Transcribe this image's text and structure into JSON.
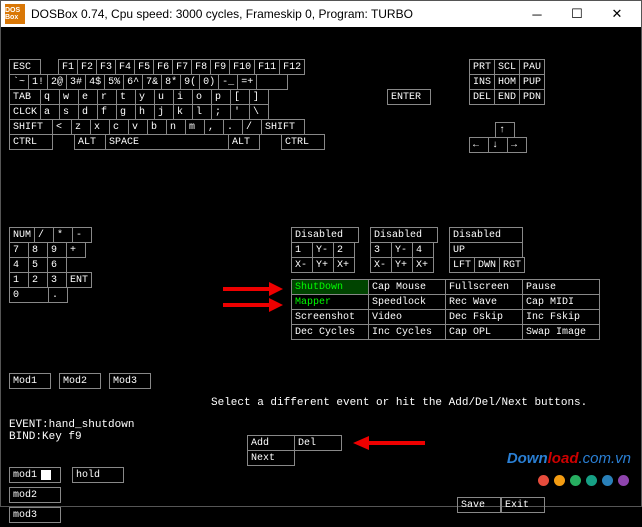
{
  "title": "DOSBox 0.74, Cpu speed:    3000 cycles, Frameskip  0, Program:    TURBO",
  "icon_text": "DOS\nBox",
  "winbtns": {
    "min": "─",
    "max": "☐",
    "close": "✕"
  },
  "kb": {
    "r0": [
      "ESC",
      "",
      "F1",
      "F2",
      "F3",
      "F4",
      "F5",
      "F6",
      "F7",
      "F8",
      "F9",
      "F10",
      "F11",
      "F12"
    ],
    "r1": [
      "`~",
      "1!",
      "2@",
      "3#",
      "4$",
      "5%",
      "6^",
      "7&",
      "8*",
      "9(",
      "0)",
      "-_",
      "=+",
      ""
    ],
    "r2": [
      "TAB",
      "q",
      "w",
      "e",
      "r",
      "t",
      "y",
      "u",
      "i",
      "o",
      "p",
      "[",
      "]"
    ],
    "r3": [
      "CLCK",
      "a",
      "s",
      "d",
      "f",
      "g",
      "h",
      "j",
      "k",
      "l",
      ";",
      "'",
      "\\"
    ],
    "r4": [
      "SHIFT",
      "<",
      "z",
      "x",
      "c",
      "v",
      "b",
      "n",
      "m",
      ",",
      ".",
      "/",
      "SHIFT"
    ],
    "r5": [
      "CTRL",
      "",
      "ALT",
      "SPACE",
      "",
      "",
      "ALT",
      "",
      "CTRL"
    ]
  },
  "kb_right": {
    "r0": [
      "PRT",
      "SCL",
      "PAU"
    ],
    "r1": [
      "INS",
      "HOM",
      "PUP"
    ],
    "r2": [
      "DEL",
      "END",
      "PDN"
    ],
    "enter": "ENTER",
    "arrows": {
      "up": "↑",
      "left": "←",
      "down": "↓",
      "right": "→"
    }
  },
  "numpad": {
    "r0": [
      "NUM",
      "/",
      "*",
      "-"
    ],
    "r1": [
      "7",
      "8",
      "9",
      "+"
    ],
    "r2": [
      "4",
      "5",
      "6"
    ],
    "r3": [
      "1",
      "2",
      "3",
      "ENT"
    ],
    "r4": [
      "0",
      ".",
      ""
    ]
  },
  "disabled": [
    {
      "title": "Disabled",
      "r1": [
        "1",
        "Y-",
        "2"
      ],
      "r2": [
        "X-",
        "Y+",
        "X+"
      ]
    },
    {
      "title": "Disabled",
      "r1": [
        "3",
        "Y-",
        "4"
      ],
      "r2": [
        "X-",
        "Y+",
        "X+"
      ]
    },
    {
      "title": "Disabled",
      "r1": [
        "UP"
      ],
      "r2": [
        "LFT",
        "DWN",
        "RGT"
      ]
    }
  ],
  "events": [
    [
      "ShutDown",
      "Cap Mouse",
      "Fullscreen",
      "Pause"
    ],
    [
      "Mapper",
      "Speedlock",
      "Rec Wave",
      "Cap MIDI"
    ],
    [
      "Screenshot",
      "Video",
      "Dec Fskip",
      "Inc Fskip"
    ],
    [
      "Dec Cycles",
      "Inc Cycles",
      "Cap OPL",
      "Swap Image"
    ]
  ],
  "mods": [
    "Mod1",
    "Mod2",
    "Mod3"
  ],
  "hint": "Select a different event or hit the Add/Del/Next buttons.",
  "event_line": "EVENT:hand_shutdown",
  "bind_line": "BIND:Key f9",
  "addnext": {
    "add": "Add",
    "del": "Del",
    "next": "Next"
  },
  "mod_bottom": {
    "mod1": "mod1",
    "hold": "hold",
    "mod2": "mod2",
    "mod3": "mod3"
  },
  "saveexit": {
    "save": "Save",
    "exit": "Exit"
  },
  "watermark": {
    "pre": "Down",
    "mid": "load",
    "suf": ".com.vn",
    "pre_color": "#2a7fd4",
    "mid_color": "#c00",
    "suf_color": "#2a7fd4"
  },
  "dots": [
    "#e74c3c",
    "#f39c12",
    "#27ae60",
    "#16a085",
    "#2980b9",
    "#8e44ad"
  ]
}
